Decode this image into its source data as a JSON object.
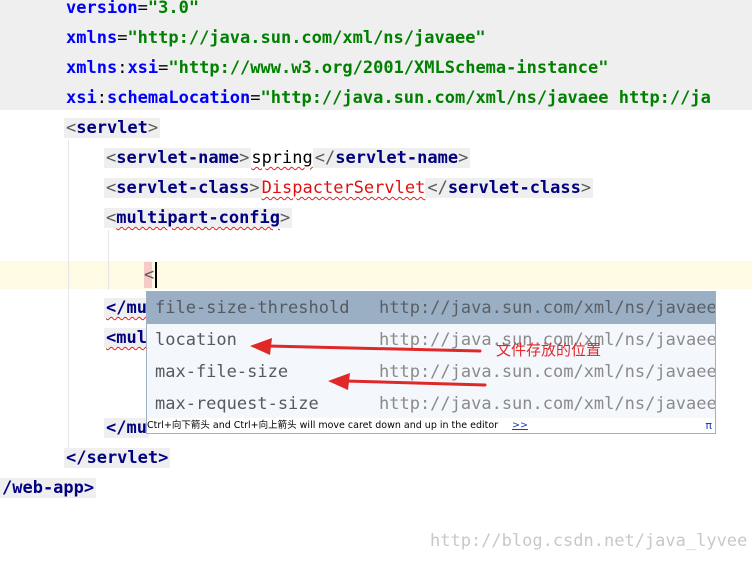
{
  "editor": {
    "line1": {
      "attr": "version",
      "eq": "=",
      "value": "\"3.0\""
    },
    "line2": {
      "attr": "xmlns",
      "eq": "=",
      "value": "\"http://java.sun.com/xml/ns/javaee\""
    },
    "line3": {
      "attr_prefix": "xmlns",
      "colon": ":",
      "attr": "xsi",
      "eq": "=",
      "value": "\"http://www.w3.org/2001/XMLSchema-instance\""
    },
    "line4": {
      "attr_prefix": "xsi",
      "colon": ":",
      "attr": "schemaLocation",
      "eq": "=",
      "value": "\"http://java.sun.com/xml/ns/javaee http://ja"
    },
    "servlet_tag": "servlet",
    "servlet_name_tag": "servlet-name",
    "servlet_name_value": "spring",
    "servlet_class_tag": "servlet-class",
    "servlet_class_value": "DispacterServlet",
    "multipart_config_tag": "multipart-config",
    "typed_char": "<",
    "close_mul_1": "</mu",
    "open_mul": "<mul",
    "close_mul_2": "</mu",
    "servlet_close": "</servlet>",
    "webapp_close": "/web-app>",
    "lt": "<",
    "gt": ">",
    "lt_slash": "</"
  },
  "completion": {
    "items": [
      {
        "name": "file-size-threshold",
        "ns": "http://java.sun.com/xml/ns/javaee",
        "selected": true
      },
      {
        "name": "location",
        "ns": "http://java.sun.com/xml/ns/javaee",
        "selected": false
      },
      {
        "name": "max-file-size",
        "ns": "http://java.sun.com/xml/ns/javaee",
        "selected": false
      },
      {
        "name": "max-request-size",
        "ns": "http://java.sun.com/xml/ns/javaee",
        "selected": false
      }
    ],
    "hint": "Ctrl+向下箭头 and Ctrl+向上箭头 will move caret down and up in the editor",
    "more_link": ">>",
    "pi_symbol": "π"
  },
  "annotation": {
    "label": "文件存放的位置",
    "color": "#e02828"
  },
  "watermark": "http://blog.csdn.net/java_lyvee"
}
